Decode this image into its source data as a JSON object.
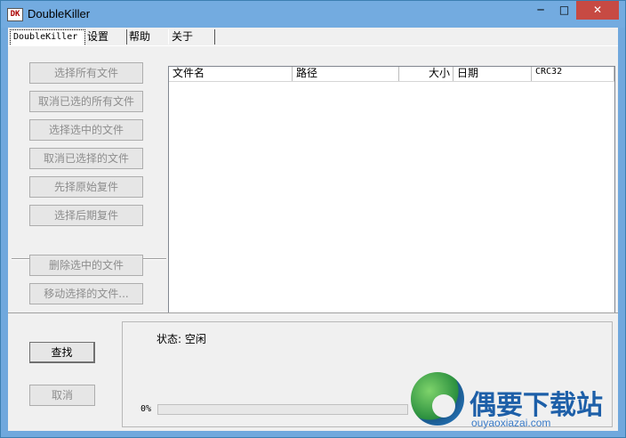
{
  "window": {
    "title": "DoubleKiller",
    "app_icon": "app-icon",
    "controls": {
      "minimize": "─",
      "maximize": "□",
      "close": "✕"
    }
  },
  "tabs": [
    {
      "label": "DoubleKiller",
      "active": true
    },
    {
      "label": "设置"
    },
    {
      "label": "帮助"
    },
    {
      "label": "关于"
    }
  ],
  "actions": {
    "select_all": "选择所有文件",
    "deselect_all": "取消已选的所有文件",
    "select_selected": "选择选中的文件",
    "deselect_selected": "取消已选择的文件",
    "select_original": "先择原始复件",
    "select_later": "选择后期复件",
    "delete_selected": "删除选中的文件",
    "move_selected": "移动选择的文件..."
  },
  "list": {
    "columns": [
      "文件名",
      "路径",
      "大小",
      "日期",
      "CRC32"
    ],
    "rows": []
  },
  "controls": {
    "find": "查找",
    "cancel": "取消"
  },
  "status": {
    "text": "状态: 空闲",
    "progress_label": "0%",
    "progress": 0.0
  },
  "watermark": {
    "name": "偶要下载站",
    "url": "ouyaoxiazai.com"
  },
  "colors": {
    "titlebar": "#73abe0",
    "close": "#c74a43",
    "progress": "#06b025"
  }
}
